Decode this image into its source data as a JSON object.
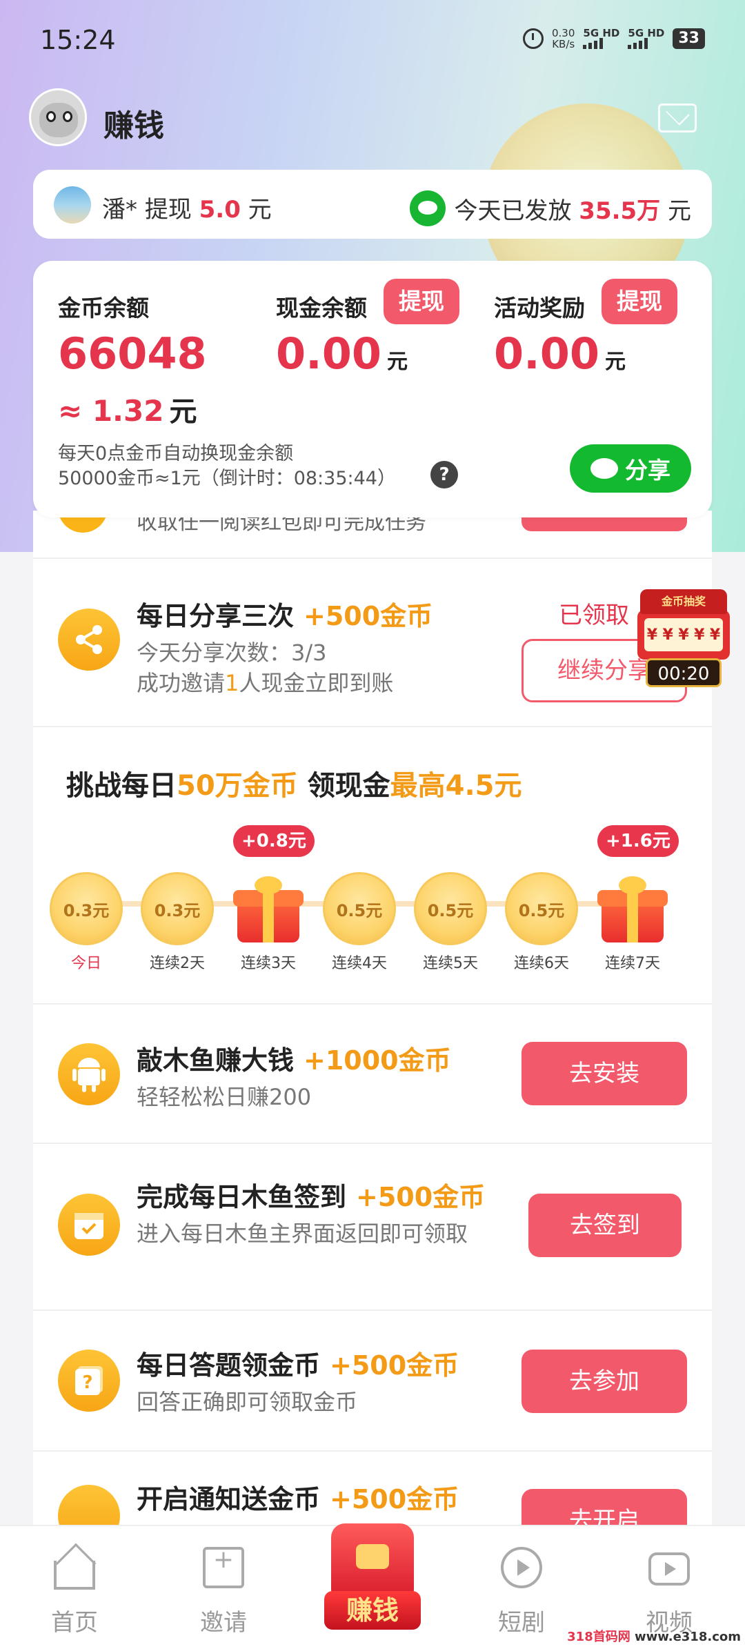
{
  "status_bar": {
    "time": "15:24",
    "net_speed_value": "0.30",
    "net_speed_unit": "KB/s",
    "sim1": "5G HD",
    "sim2": "5G HD",
    "battery": "33"
  },
  "header": {
    "title": "赚钱"
  },
  "ticker": {
    "user": "潘*",
    "action": "提现",
    "amount": "5.0",
    "unit": "元",
    "today_label": "今天已发放",
    "today_amount": "35.5万",
    "today_unit": "元"
  },
  "balance": {
    "coin_label": "金币余额",
    "coin_value": "66048",
    "coin_approx_prefix": "≈",
    "coin_approx_value": "1.32",
    "coin_approx_unit": "元",
    "cash_label": "现金余额",
    "cash_value": "0.00",
    "cash_unit": "元",
    "cash_button": "提现",
    "reward_label": "活动奖励",
    "reward_value": "0.00",
    "reward_unit": "元",
    "reward_button": "提现",
    "note_line1": "每天0点金币自动换现金余额",
    "note_line2": "50000金币≈1元（倒计时：08:35:44）",
    "help": "?",
    "share_button": "分享"
  },
  "tasks": {
    "hidden_partial_text": "收取任一阅读红包即可完成任务",
    "share": {
      "title": "每日分享三次",
      "reward": "+500金币",
      "desc1": "今天分享次数：3/3",
      "desc2_pre": "成功邀请",
      "desc2_num": "1",
      "desc2_post": "人现金立即到账",
      "status": "已领取",
      "button": "继续分享"
    },
    "muyu": {
      "title": "敲木鱼赚大钱",
      "reward": "+1000金币",
      "desc": "轻轻松松日赚200",
      "button": "去安装"
    },
    "signin": {
      "title": "完成每日木鱼签到",
      "reward": "+500金币",
      "desc": "进入每日木鱼主界面返回即可领取",
      "button": "去签到"
    },
    "quiz": {
      "title": "每日答题领金币",
      "reward": "+500金币",
      "desc": "回答正确即可领取金币",
      "button": "去参加"
    },
    "notify": {
      "title": "开启通知送金币",
      "reward": "+500金币",
      "button": "去开启"
    }
  },
  "challenge": {
    "t1": "挑战每日",
    "t2": "50万金币",
    "t3": " 领现金",
    "t4": "最高4.5元",
    "days": [
      {
        "amount": "0.3元",
        "label": "今日",
        "type": "coin"
      },
      {
        "amount": "0.3元",
        "label": "连续2天",
        "type": "coin"
      },
      {
        "amount": "",
        "label": "连续3天",
        "type": "gift",
        "bonus": "+0.8元"
      },
      {
        "amount": "0.5元",
        "label": "连续4天",
        "type": "coin"
      },
      {
        "amount": "0.5元",
        "label": "连续5天",
        "type": "coin"
      },
      {
        "amount": "0.5元",
        "label": "连续6天",
        "type": "coin"
      },
      {
        "amount": "",
        "label": "连续7天",
        "type": "gift",
        "bonus": "+1.6元"
      }
    ]
  },
  "lottery": {
    "title": "金币抽奖",
    "slots": [
      "¥",
      "¥",
      "¥",
      "¥",
      "¥"
    ],
    "timer": "00:20"
  },
  "nav": {
    "home": "首页",
    "invite": "邀请",
    "earn": "赚钱",
    "drama": "短剧",
    "video": "视频"
  },
  "watermark": {
    "a": "318首码网",
    "b": " www.e318.com"
  },
  "colors": {
    "accent_red": "#f25a6b",
    "reward_orange": "#f39a16",
    "wechat_green": "#13b92e"
  }
}
